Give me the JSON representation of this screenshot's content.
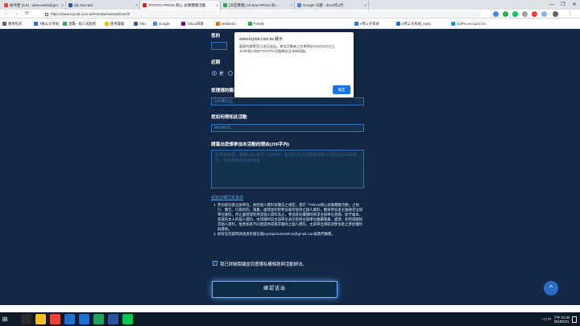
{
  "browser": {
    "tabs": [
      {
        "title": "收件匣 (8.9) - aleeeu945@gmail...",
        "color": "#ea4335"
      },
      {
        "title": "(9) Alex Wu",
        "color": "#3b5998"
      },
      {
        "title": "TOYOTA PRIUS 夠心 試乘體驗活動",
        "color": "#e0201a"
      },
      {
        "title": "[深度實驗] All New PRIUS 純...",
        "color": "#2ea44f"
      },
      {
        "title": "Google 日曆 - 2019年2月",
        "color": "#4285f4"
      }
    ],
    "tab_close": "×",
    "window_controls": [
      "—",
      "❐",
      "✕"
    ],
    "nav": {
      "back": "←",
      "forward": "→",
      "reload": "⟳"
    },
    "url": "https://www.toyota.com.tw/event/priustestdrive/ol/",
    "bookmarks": [
      {
        "label": "應用程式",
        "color": "#5f6368"
      },
      {
        "label": "T帳公文系統",
        "color": "#1a73e8"
      },
      {
        "label": "瀏覽 - 個人化服務",
        "color": "#34a853"
      },
      {
        "label": "使用書籤",
        "color": "#fbbc05"
      },
      {
        "label": "Alex",
        "color": "#3b5998"
      },
      {
        "label": "Google",
        "color": "#4285f4"
      },
      {
        "label": "Yahoo奇摩",
        "color": "#7b0099"
      },
      {
        "label": "Mobile01",
        "color": "#e8710a"
      },
      {
        "label": "Feedly",
        "color": "#2bb24c"
      },
      {
        "label": "e幣公文系統",
        "color": "#1a73e8"
      },
      {
        "label": "e幣公文系統_ep01",
        "color": "#1a73e8"
      },
      {
        "label": "GoPro Account Ce...",
        "color": "#00a0e0"
      }
    ],
    "bookmark_marker": "系統"
  },
  "form": {
    "partial_label_1": "您的",
    "partial_label_2": "近期",
    "radio_yes": "是",
    "radio_no": "否",
    "budget_label": "您理想的購車預算",
    "budget_value": "120萬以上",
    "source_label": "您如何得知此活動",
    "source_value": "Mobile01",
    "reason_label": "請寫出您想參加本活動的理由(200字內)",
    "reason_value": "我很有興趣，觀察prius車款一段時間，想透過這次試乘體驗車子的性能與油電特性，作為購車的參考依據",
    "terms_title": "個資授權同意事項",
    "terms_items": [
      "參加者同意主辦單位，依照個人資料保護法之規定，基於「PRIUS夠心試乘體驗活動」之執行、廣告、行銷目的，蒐集、處理並利用參加者所提供之個人資料，觀眾參加者主動請求主辦單位刪除，停止處理或利用其個人資料為止。參加者有權隨時請求主辦單位查閱、給予複本、或補充本人的個人資料，亦得隨時向主辦單位表示拒絕主辦單位繼續蒐集、處理、利用或刪除其個人資料，惟參加者不同意提供或要求刪除之個人資料，主辦單位將取消參加者之參加權利與資格。",
      "如有任何疑問請透過客服信箱toyotapriustestdrive@gmail.com與我們聯繫。"
    ],
    "agree_check": "✓",
    "agree_text": "我已詳細閱讀並同意隱私權條款與活動辦法。",
    "submit": "確認送出"
  },
  "scroll_top": "^",
  "dialog": {
    "title": "www.toyota.com.tw 顯示",
    "message": "親愛的貴賓您已成功送出。參加活動者之名單將於2019/2/27(三) 18:00前公佈於TOYOTA活動網站及本粉絲團。",
    "ok": "確定"
  },
  "taskbar": {
    "start": "⊞",
    "apps": [
      "#2b2b2b",
      "#f2c02c",
      "#e8453c",
      "#1f6fd1",
      "#1f6fd1",
      "#21a366",
      "#2b579a",
      "#06c755"
    ],
    "tray": "^ 口 中",
    "time": "下午 01:30",
    "date": "2019/2/21"
  }
}
